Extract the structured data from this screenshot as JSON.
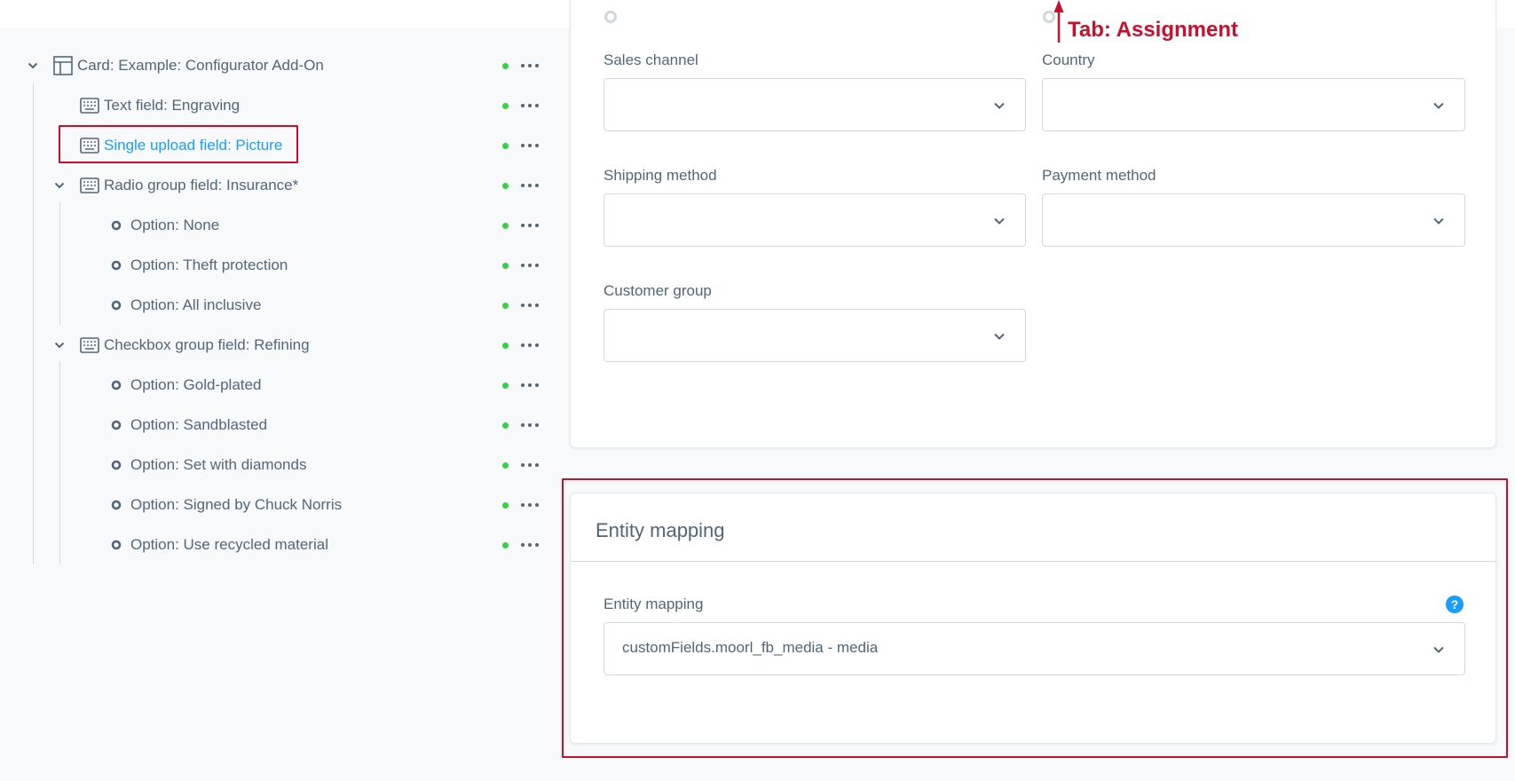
{
  "annotation": {
    "tab_label": "Tab: Assignment",
    "color": "#c8102e"
  },
  "faded_option_text": " ",
  "tree": {
    "items": [
      {
        "label": "Card: Example: Configurator Add-On",
        "icon": "layout-card-icon",
        "level": 0,
        "expanded": true
      },
      {
        "label": "Text field: Engraving",
        "icon": "keyboard-icon",
        "level": 1
      },
      {
        "label": "Single upload field: Picture",
        "icon": "keyboard-icon",
        "level": 1,
        "active": true
      },
      {
        "label": "Radio group field: Insurance*",
        "icon": "keyboard-icon",
        "level": 1,
        "expanded": true
      },
      {
        "label": "Option: None",
        "icon": "circle-option-icon",
        "level": 2
      },
      {
        "label": "Option: Theft protection",
        "icon": "circle-option-icon",
        "level": 2
      },
      {
        "label": "Option: All inclusive",
        "icon": "circle-option-icon",
        "level": 2
      },
      {
        "label": "Checkbox group field: Refining",
        "icon": "keyboard-icon",
        "level": 1,
        "expanded": true
      },
      {
        "label": "Option: Gold-plated",
        "icon": "circle-option-icon",
        "level": 2
      },
      {
        "label": "Option: Sandblasted",
        "icon": "circle-option-icon",
        "level": 2
      },
      {
        "label": "Option: Set with diamonds",
        "icon": "circle-option-icon",
        "level": 2
      },
      {
        "label": "Option: Signed by Chuck Norris",
        "icon": "circle-option-icon",
        "level": 2
      },
      {
        "label": "Option: Use recycled material",
        "icon": "circle-option-icon",
        "level": 2
      }
    ],
    "status_color": "#37d046"
  },
  "assignment_card": {
    "sales_channel_label": "Sales channel",
    "country_label": "Country",
    "shipping_method_label": "Shipping method",
    "payment_method_label": "Payment method",
    "customer_group_label": "Customer group",
    "sales_channel_value": "",
    "country_value": "",
    "shipping_method_value": "",
    "payment_method_value": "",
    "customer_group_value": ""
  },
  "entity_mapping_card": {
    "title": "Entity mapping",
    "field_label": "Entity mapping",
    "field_value": "customFields.moorl_fb_media - media",
    "help_icon": "?"
  },
  "colors": {
    "accent": "#189eff",
    "text": "#52667a",
    "border": "#d1d9e0"
  }
}
